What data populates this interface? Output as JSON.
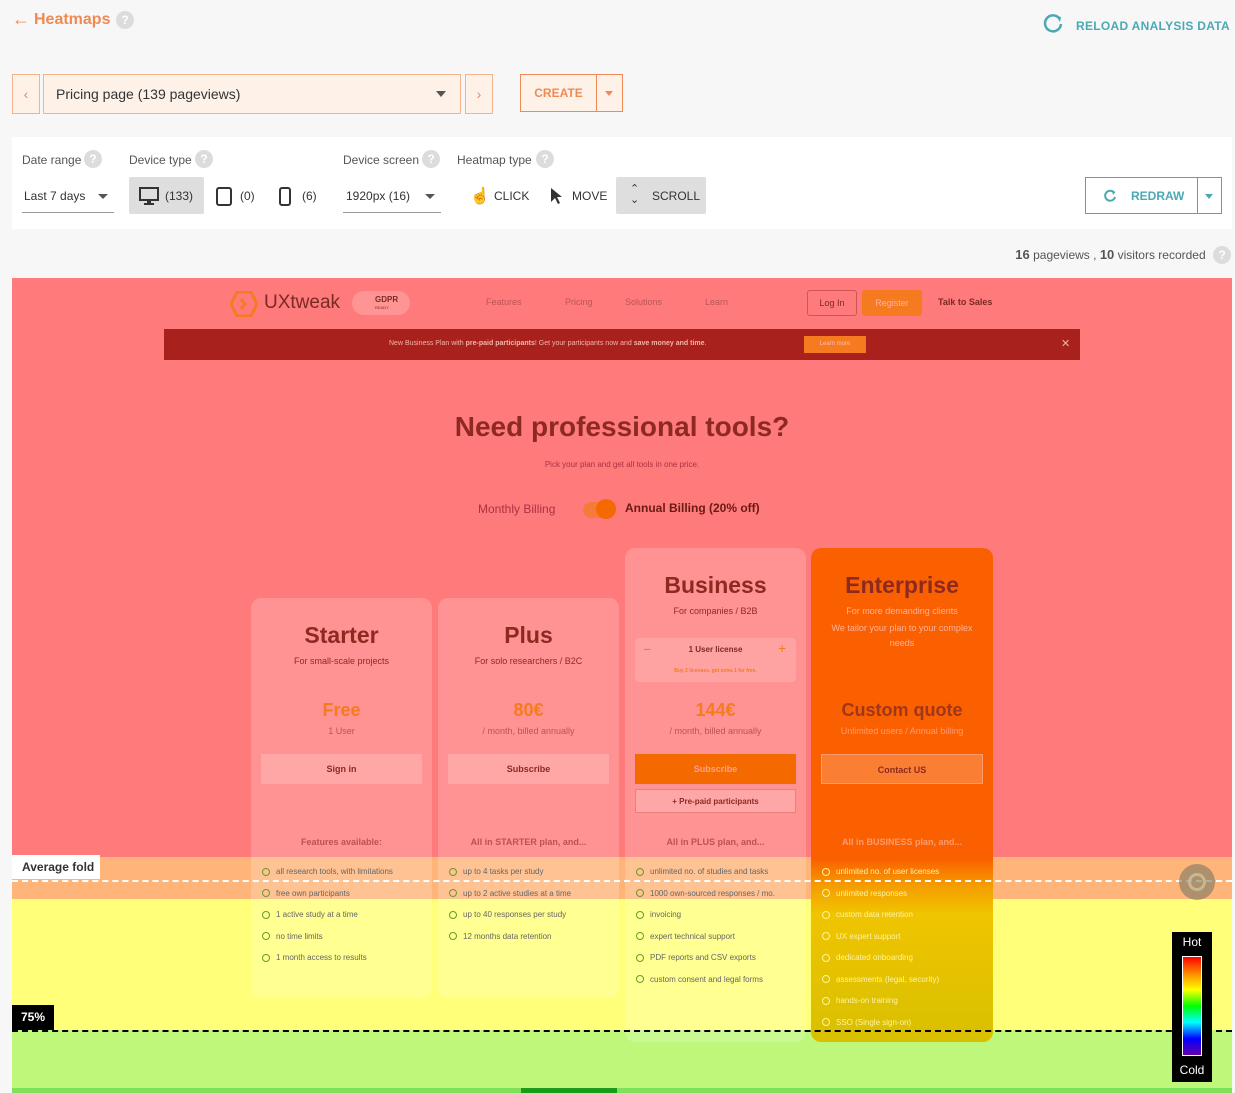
{
  "header": {
    "title": "Heatmaps",
    "help": "?",
    "reload_label": "RELOAD ANALYSIS DATA"
  },
  "page_select": {
    "value": "Pricing page (139 pageviews)",
    "prev": "‹",
    "next": "›"
  },
  "create": {
    "label": "CREATE"
  },
  "filters": {
    "date_range": {
      "label": "Date range",
      "value": "Last 7 days"
    },
    "device_type": {
      "label": "Device type",
      "desktop": "(133)",
      "tablet": "(0)",
      "mobile": "(6)"
    },
    "device_screen": {
      "label": "Device screen",
      "value": "1920px (16)"
    },
    "heatmap_type": {
      "label": "Heatmap type",
      "click": "CLICK",
      "move": "MOVE",
      "scroll": "SCROLL"
    },
    "redraw": "REDRAW"
  },
  "stats": {
    "pageviews": "16",
    "pageviews_label": "pageviews ,",
    "visitors": "10",
    "visitors_label": "visitors recorded"
  },
  "site": {
    "logo": "UXtweak",
    "gdpr": "GDPR",
    "gdpr_sub": "READY",
    "nav": [
      "Features",
      "Pricing",
      "Solutions",
      "Learn"
    ],
    "login": "Log In",
    "register": "Register",
    "talk": "Talk to Sales",
    "banner_pre": "New Business Plan with ",
    "banner_bold1": "pre-paid participants",
    "banner_mid": "! Get your participants now and ",
    "banner_bold2": "save money and time",
    "banner_end": ".",
    "banner_btn": "Learn more",
    "heading": "Need professional tools?",
    "subheading": "Pick your plan and get all tools in one price.",
    "billing_monthly": "Monthly Billing",
    "billing_annual": "Annual Billing (20% off)",
    "plans": [
      {
        "name": "Starter",
        "sub": "For small-scale projects",
        "price": "Free",
        "price_sub": "1 User",
        "btn": "Sign in",
        "feat_head": "Features available:",
        "features": [
          "all research tools, with limitations",
          "free own participants",
          "1 active study at a time",
          "no time limits",
          "1 month access to results"
        ]
      },
      {
        "name": "Plus",
        "sub": "For solo researchers / B2C",
        "price": "80€",
        "price_sub": "/ month, billed annually",
        "btn": "Subscribe",
        "feat_head": "All in STARTER plan, and...",
        "features": [
          "up to 4 tasks per study",
          "up to 2 active studies at a time",
          "up to 40 responses per study",
          "12 months data retention"
        ]
      },
      {
        "name": "Business",
        "sub": "For companies / B2B",
        "license": "1 User license",
        "license_note": "Buy 2 licenses, get extra 1 for free.",
        "price": "144€",
        "price_sub": "/ month, billed annually",
        "btn": "Subscribe",
        "btn2": "+ Pre-paid participants",
        "feat_head": "All in PLUS plan, and...",
        "features": [
          "unlimited no. of studies and tasks",
          "1000 own-sourced responses / mo.",
          "invoicing",
          "expert technical support",
          "PDF reports and CSV exports",
          "custom consent and legal forms"
        ]
      },
      {
        "name": "Enterprise",
        "sub": "For more demanding clients",
        "sub2": "We tailor your plan to your complex needs",
        "price": "Custom quote",
        "price_sub": "Unlimited users / Annual billing",
        "btn": "Contact US",
        "feat_head": "All in BUSINESS plan, and...",
        "features": [
          "unlimited no. of user licenses",
          "unlimited responses",
          "custom data retention",
          "UX expert support",
          "dedicated onboarding",
          "assessments (legal, security)",
          "hands-on training",
          "SSO (Single sign-on)"
        ]
      }
    ]
  },
  "overlay": {
    "average_fold": "Average fold",
    "p75": "75%",
    "legend_hot": "Hot",
    "legend_cold": "Cold"
  },
  "colors": {
    "accent": "#f08a54",
    "teal": "#4aa9b3",
    "heat_red": "#ff7a7a",
    "heat_yellow": "#ffff7a",
    "heat_green": "#bff77a"
  }
}
